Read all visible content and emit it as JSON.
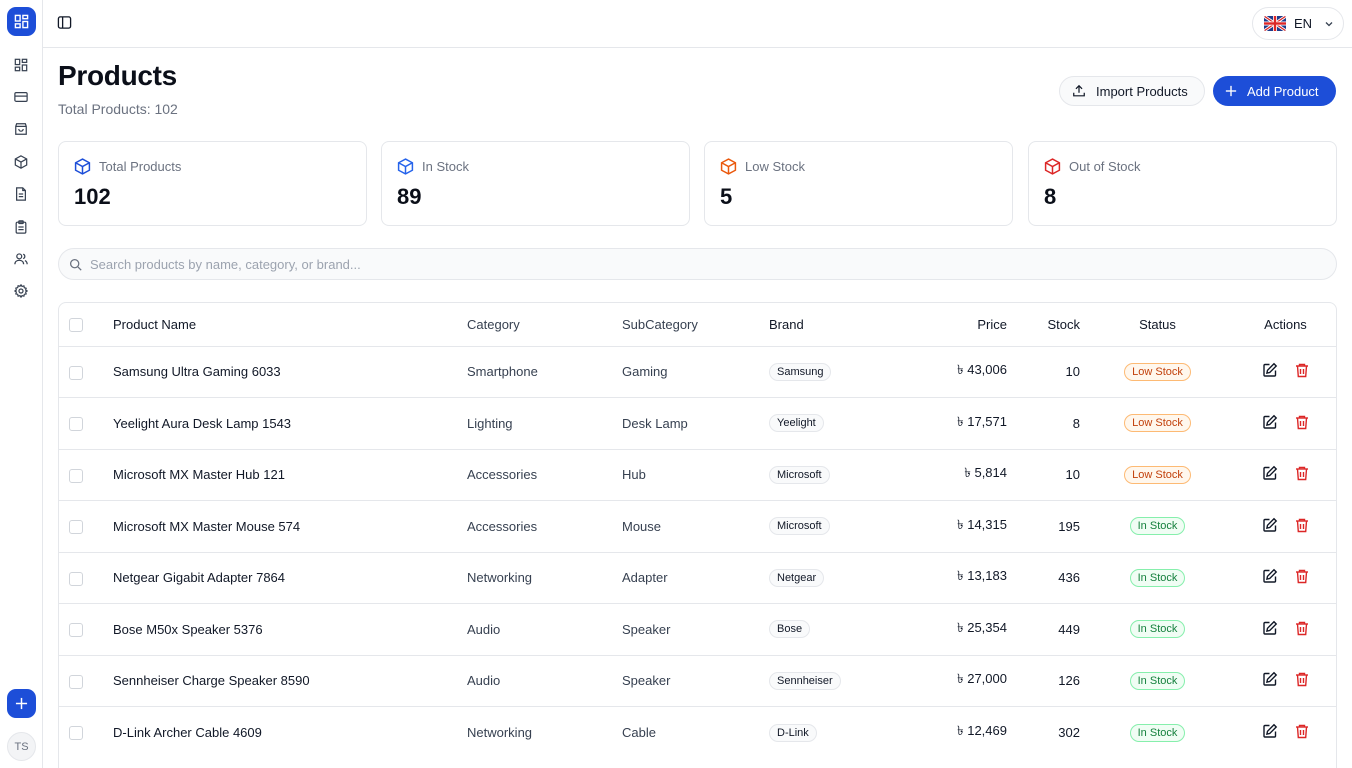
{
  "sidebar": {
    "logo_icon": "dashboard-grid-icon",
    "items": [
      {
        "icon": "dashboard-icon"
      },
      {
        "icon": "credit-card-icon"
      },
      {
        "icon": "shopping-bag-icon"
      },
      {
        "icon": "package-icon"
      },
      {
        "icon": "file-text-icon"
      },
      {
        "icon": "clipboard-icon"
      },
      {
        "icon": "users-icon"
      },
      {
        "icon": "settings-icon"
      }
    ],
    "fab_icon": "plus-icon",
    "avatar_initials": "TS"
  },
  "topbar": {
    "toggle_icon": "sidebar-toggle-icon",
    "language": "EN",
    "flag_icon": "uk-flag-icon",
    "chevron_icon": "chevron-down-icon"
  },
  "header": {
    "title": "Products",
    "subtitle": "Total Products: 102",
    "import_label": "Import Products",
    "add_label": "Add Product"
  },
  "stats": [
    {
      "label": "Total Products",
      "value": "102",
      "color": "#1d4ed8"
    },
    {
      "label": "In Stock",
      "value": "89",
      "color": "#2563eb"
    },
    {
      "label": "Low Stock",
      "value": "5",
      "color": "#ea580c"
    },
    {
      "label": "Out of Stock",
      "value": "8",
      "color": "#dc2626"
    }
  ],
  "search": {
    "placeholder": "Search products by name, category, or brand..."
  },
  "table": {
    "headers": {
      "name": "Product Name",
      "category": "Category",
      "subcategory": "SubCategory",
      "brand": "Brand",
      "price": "Price",
      "stock": "Stock",
      "status": "Status",
      "actions": "Actions"
    },
    "rows": [
      {
        "name": "Samsung Ultra Gaming 6033",
        "category": "Smartphone",
        "subcategory": "Gaming",
        "brand": "Samsung",
        "price": "৳ 43,006",
        "stock": "10",
        "status": "Low Stock"
      },
      {
        "name": "Yeelight Aura Desk Lamp 1543",
        "category": "Lighting",
        "subcategory": "Desk Lamp",
        "brand": "Yeelight",
        "price": "৳ 17,571",
        "stock": "8",
        "status": "Low Stock"
      },
      {
        "name": "Microsoft MX Master Hub 121",
        "category": "Accessories",
        "subcategory": "Hub",
        "brand": "Microsoft",
        "price": "৳ 5,814",
        "stock": "10",
        "status": "Low Stock"
      },
      {
        "name": "Microsoft MX Master Mouse 574",
        "category": "Accessories",
        "subcategory": "Mouse",
        "brand": "Microsoft",
        "price": "৳ 14,315",
        "stock": "195",
        "status": "In Stock"
      },
      {
        "name": "Netgear Gigabit Adapter 7864",
        "category": "Networking",
        "subcategory": "Adapter",
        "brand": "Netgear",
        "price": "৳ 13,183",
        "stock": "436",
        "status": "In Stock"
      },
      {
        "name": "Bose M50x Speaker 5376",
        "category": "Audio",
        "subcategory": "Speaker",
        "brand": "Bose",
        "price": "৳ 25,354",
        "stock": "449",
        "status": "In Stock"
      },
      {
        "name": "Sennheiser Charge Speaker 8590",
        "category": "Audio",
        "subcategory": "Speaker",
        "brand": "Sennheiser",
        "price": "৳ 27,000",
        "stock": "126",
        "status": "In Stock"
      },
      {
        "name": "D-Link Archer Cable 4609",
        "category": "Networking",
        "subcategory": "Cable",
        "brand": "D-Link",
        "price": "৳ 12,469",
        "stock": "302",
        "status": "In Stock"
      }
    ]
  },
  "colors": {
    "accent": "#1d4ed8",
    "low_stock": "#c2410c",
    "in_stock": "#15803d",
    "delete": "#dc2626"
  }
}
